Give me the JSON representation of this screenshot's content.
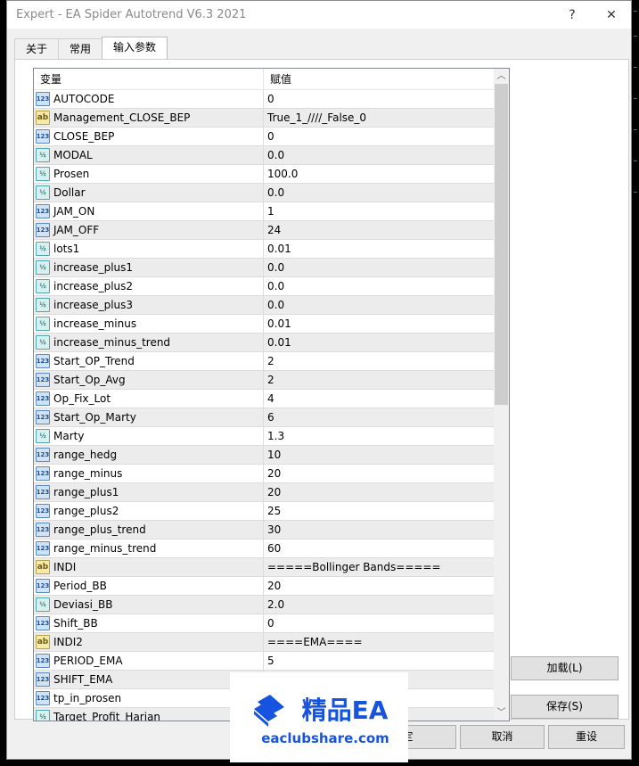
{
  "window": {
    "title": "Expert - EA Spider Autotrend V6.3 2021",
    "help": "?",
    "close": "✕"
  },
  "tabs": [
    {
      "label": "关于"
    },
    {
      "label": "常用"
    },
    {
      "label": "输入参数",
      "active": true
    }
  ],
  "table": {
    "headers": [
      "变量",
      "赋值"
    ],
    "rows": [
      {
        "type": "int",
        "name": "AUTOCODE",
        "value": "0"
      },
      {
        "type": "str",
        "name": "Management_CLOSE_BEP",
        "value": "True_1_////_False_0"
      },
      {
        "type": "int",
        "name": "CLOSE_BEP",
        "value": "0"
      },
      {
        "type": "dbl",
        "name": "MODAL",
        "value": "0.0"
      },
      {
        "type": "dbl",
        "name": "Prosen",
        "value": "100.0"
      },
      {
        "type": "dbl",
        "name": "Dollar",
        "value": "0.0"
      },
      {
        "type": "int",
        "name": "JAM_ON",
        "value": "1"
      },
      {
        "type": "int",
        "name": "JAM_OFF",
        "value": "24"
      },
      {
        "type": "dbl",
        "name": "lots1",
        "value": "0.01"
      },
      {
        "type": "dbl",
        "name": "increase_plus1",
        "value": "0.0"
      },
      {
        "type": "dbl",
        "name": "increase_plus2",
        "value": "0.0"
      },
      {
        "type": "dbl",
        "name": "increase_plus3",
        "value": "0.0"
      },
      {
        "type": "dbl",
        "name": "increase_minus",
        "value": "0.01"
      },
      {
        "type": "dbl",
        "name": "increase_minus_trend",
        "value": "0.01"
      },
      {
        "type": "int",
        "name": "Start_OP_Trend",
        "value": "2"
      },
      {
        "type": "int",
        "name": "Start_Op_Avg",
        "value": "2"
      },
      {
        "type": "int",
        "name": "Op_Fix_Lot",
        "value": "4"
      },
      {
        "type": "int",
        "name": "Start_Op_Marty",
        "value": "6"
      },
      {
        "type": "dbl",
        "name": "Marty",
        "value": "1.3"
      },
      {
        "type": "int",
        "name": "range_hedg",
        "value": "10"
      },
      {
        "type": "int",
        "name": "range_minus",
        "value": "20"
      },
      {
        "type": "int",
        "name": "range_plus1",
        "value": "20"
      },
      {
        "type": "int",
        "name": "range_plus2",
        "value": "25"
      },
      {
        "type": "int",
        "name": "range_plus_trend",
        "value": "30"
      },
      {
        "type": "int",
        "name": "range_minus_trend",
        "value": "60"
      },
      {
        "type": "str",
        "name": "INDI",
        "value": "=====Bollinger Bands====="
      },
      {
        "type": "int",
        "name": "Period_BB",
        "value": "20"
      },
      {
        "type": "dbl",
        "name": "Deviasi_BB",
        "value": "2.0"
      },
      {
        "type": "int",
        "name": "Shift_BB",
        "value": "0"
      },
      {
        "type": "str",
        "name": "INDI2",
        "value": "====EMA===="
      },
      {
        "type": "int",
        "name": "PERIOD_EMA",
        "value": "5"
      },
      {
        "type": "int",
        "name": "SHIFT_EMA",
        "value": ""
      },
      {
        "type": "int",
        "name": "tp_in_prosen",
        "value": ""
      },
      {
        "type": "dbl",
        "name": "Target_Profit_Harian",
        "value": ""
      }
    ]
  },
  "icon_labels": {
    "int": "123",
    "str": "ab",
    "dbl": "½"
  },
  "buttons": {
    "load": "加载(L)",
    "save": "保存(S)",
    "ok": "确定",
    "cancel": "取消",
    "reset": "重设"
  },
  "watermark": {
    "brand": "精品EA",
    "url": "eaclubshare.com"
  },
  "colors": {
    "accent": "#1654e0"
  }
}
